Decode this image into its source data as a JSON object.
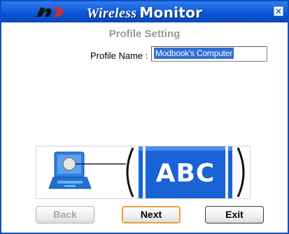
{
  "window": {
    "title_italic": "Wireless",
    "title_bold": "Monitor",
    "close_glyph": "×"
  },
  "page": {
    "subtitle": "Profile Setting"
  },
  "form": {
    "profile_label": "Profile Name :",
    "profile_value": "Modbook's Computer"
  },
  "illustration": {
    "text": "ABC"
  },
  "buttons": {
    "back": "Back",
    "next": "Next",
    "exit": "Exit"
  },
  "colors": {
    "titlebar": "#0c57d6",
    "accent_blue": "#1a63d6",
    "logo_red": "#e0261c",
    "next_border": "#e6a33a"
  },
  "icons": {
    "logo": "brand-logo-icon",
    "close": "close-icon",
    "laptop": "laptop-icon"
  }
}
